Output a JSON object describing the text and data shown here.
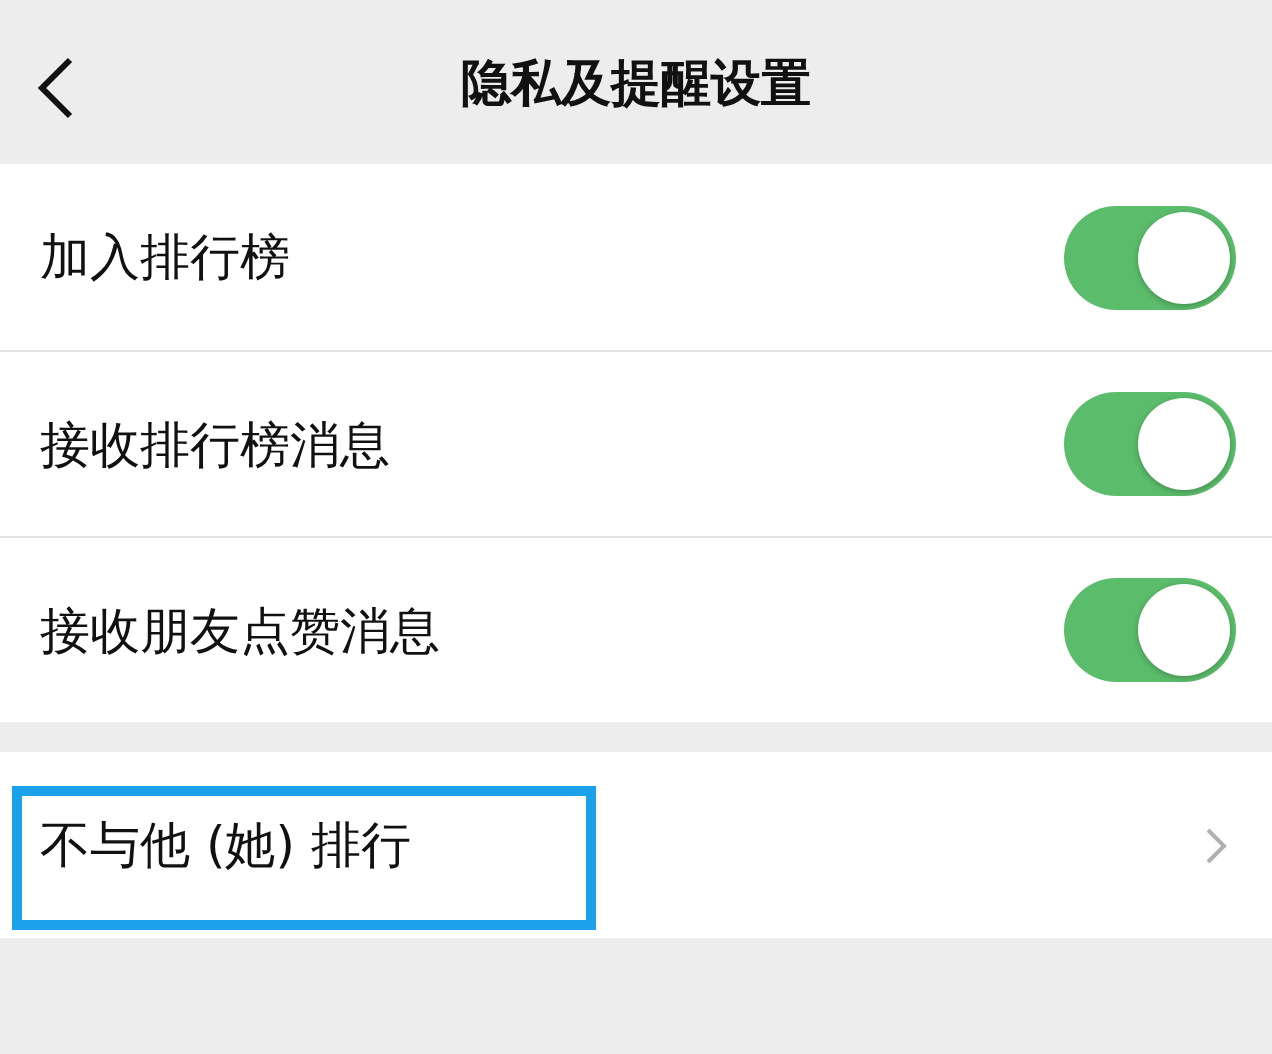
{
  "header": {
    "title": "隐私及提醒设置"
  },
  "toggles": [
    {
      "label": "加入排行榜",
      "on": true
    },
    {
      "label": "接收排行榜消息",
      "on": true
    },
    {
      "label": "接收朋友点赞消息",
      "on": true
    }
  ],
  "links": [
    {
      "label": "不与他 (她) 排行",
      "highlighted": true
    }
  ]
}
